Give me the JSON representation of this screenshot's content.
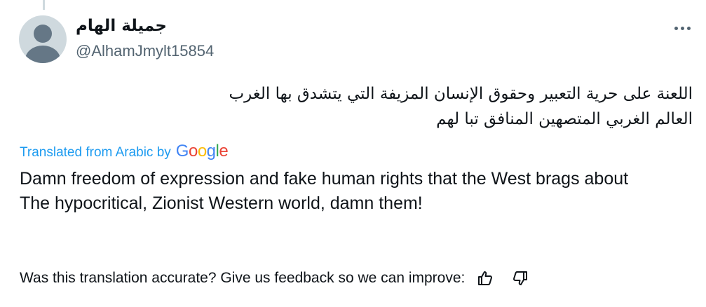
{
  "tweet": {
    "author": {
      "display_name": "جميلة الهام",
      "handle": "@AlhamJmylt15854"
    },
    "text_ar": {
      "line1": "اللعنة على حرية التعبير وحقوق الإنسان المزيفة التي يتشدق بها الغرب",
      "line2": "العالم الغربي المتصهين المنافق تبا لهم"
    },
    "translation": {
      "label": "Translated from Arabic by",
      "provider_letters": [
        {
          "ch": "G",
          "color": "#4285F4"
        },
        {
          "ch": "o",
          "color": "#EA4335"
        },
        {
          "ch": "o",
          "color": "#FBBC05"
        },
        {
          "ch": "g",
          "color": "#4285F4"
        },
        {
          "ch": "l",
          "color": "#34A853"
        },
        {
          "ch": "e",
          "color": "#EA4335"
        }
      ],
      "line1": "Damn freedom of expression and fake human rights that the West brags about",
      "line2": "The hypocritical, Zionist Western world, damn them!"
    },
    "feedback": {
      "prompt": "Was this translation accurate? Give us feedback so we can improve:",
      "thumbs_up_icon": "thumbs-up-icon",
      "thumbs_down_icon": "thumbs-down-icon"
    },
    "more_icon": "more-horizontal-icon"
  },
  "colors": {
    "text": "#0f1419",
    "secondary": "#536471",
    "link": "#1d9bf0",
    "avatar_bg": "#cfd9de",
    "avatar_fg": "#657786"
  }
}
